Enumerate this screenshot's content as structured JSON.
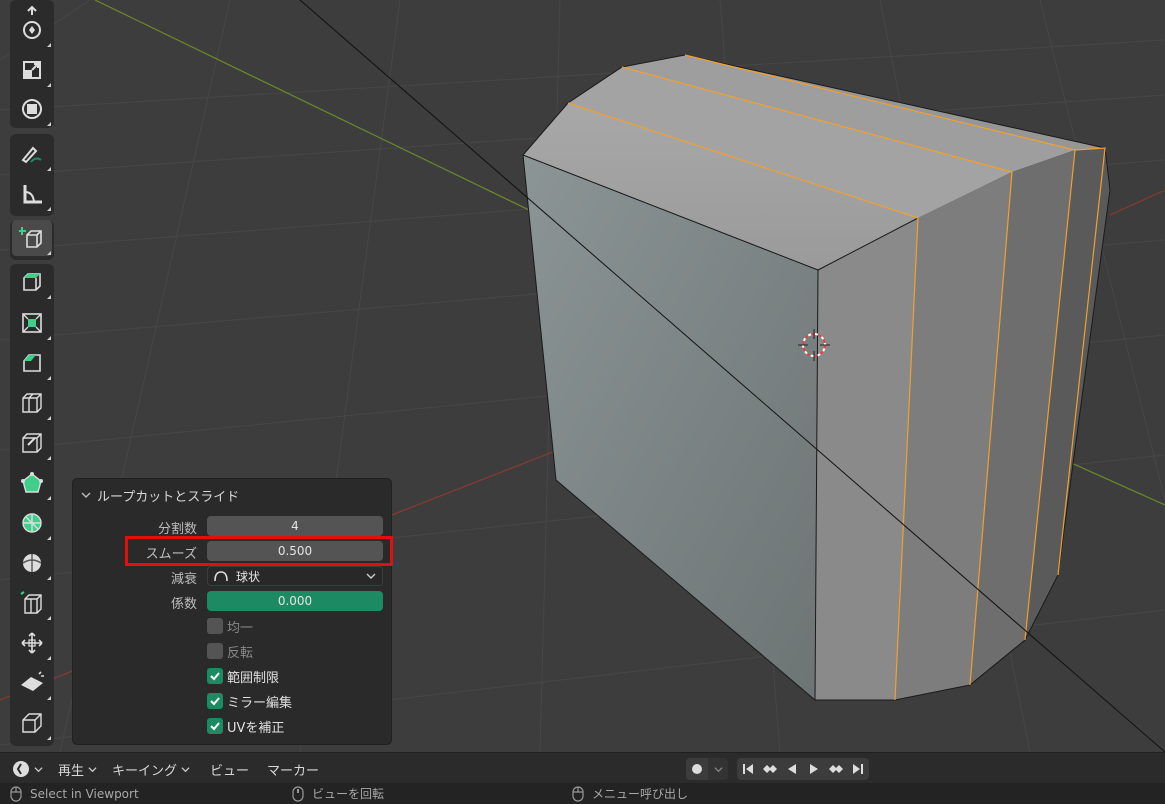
{
  "operator_panel": {
    "title": "ループカットとスライド",
    "fields": {
      "cuts_label": "分割数",
      "cuts_value": "4",
      "smooth_label": "スムーズ",
      "smooth_value": "0.500",
      "falloff_label": "減衰",
      "falloff_value": "球状",
      "factor_label": "係数",
      "factor_value": "0.000"
    },
    "checkboxes": [
      {
        "label": "均一",
        "checked": false
      },
      {
        "label": "反転",
        "checked": false
      },
      {
        "label": "範囲制限",
        "checked": true
      },
      {
        "label": "ミラー編集",
        "checked": true
      },
      {
        "label": "UVを補正",
        "checked": true
      }
    ],
    "highlight_color": "#e01010",
    "accent_color": "#1c8a63"
  },
  "timeline": {
    "playback_label": "再生",
    "keying_label": "キーイング",
    "view_label": "ビュー",
    "marker_label": "マーカー"
  },
  "statusbar": {
    "left_hint": "Select in Viewport",
    "middle_hint": "ビューを回転",
    "right_hint": "メニュー呼び出し"
  },
  "toolbar": {
    "tools": [
      "rotate-tool-icon",
      "scale-tool-icon",
      "transform-tool-icon",
      "annotate-tool-icon",
      "measure-tool-icon",
      "add-cube-tool-icon",
      "extrude-tool-icon",
      "inset-tool-icon",
      "bevel-tool-icon",
      "loop-cut-tool-icon",
      "knife-tool-icon",
      "poly-build-tool-icon",
      "spin-tool-icon",
      "smooth-tool-icon",
      "edge-slide-tool-icon",
      "shrink-fatten-tool-icon",
      "shear-tool-icon",
      "rip-tool-icon"
    ]
  }
}
